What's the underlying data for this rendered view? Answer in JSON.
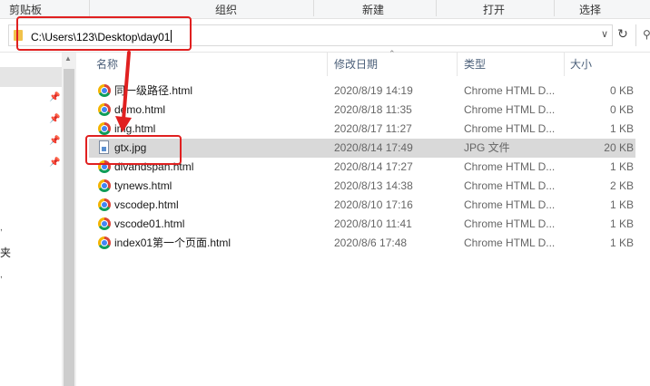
{
  "ribbon": {
    "groups": [
      "剪贴板",
      "组织",
      "新建",
      "打开",
      "选择"
    ]
  },
  "address": {
    "path": "C:\\Users\\123\\Desktop\\day01"
  },
  "nav": {
    "partial_item": "夹"
  },
  "columns": {
    "name": "名称",
    "date": "修改日期",
    "type": "类型",
    "size": "大小"
  },
  "files": [
    {
      "name": "同一级路径.html",
      "date": "2020/8/19 14:19",
      "type": "Chrome HTML D...",
      "size": "0 KB",
      "icon": "chrome-icon"
    },
    {
      "name": "demo.html",
      "date": "2020/8/18 11:35",
      "type": "Chrome HTML D...",
      "size": "0 KB",
      "icon": "chrome-icon"
    },
    {
      "name": "img.html",
      "date": "2020/8/17 11:27",
      "type": "Chrome HTML D...",
      "size": "1 KB",
      "icon": "chrome-icon"
    },
    {
      "name": "gtx.jpg",
      "date": "2020/8/14 17:49",
      "type": "JPG 文件",
      "size": "20 KB",
      "icon": "jpg-file-icon"
    },
    {
      "name": "divandspan.html",
      "date": "2020/8/14 17:27",
      "type": "Chrome HTML D...",
      "size": "1 KB",
      "icon": "chrome-icon"
    },
    {
      "name": "tynews.html",
      "date": "2020/8/13 14:38",
      "type": "Chrome HTML D...",
      "size": "2 KB",
      "icon": "chrome-icon"
    },
    {
      "name": "vscodep.html",
      "date": "2020/8/10 17:16",
      "type": "Chrome HTML D...",
      "size": "1 KB",
      "icon": "chrome-icon"
    },
    {
      "name": "vscode01.html",
      "date": "2020/8/10 11:41",
      "type": "Chrome HTML D...",
      "size": "1 KB",
      "icon": "chrome-icon"
    },
    {
      "name": "index01第一个页面.html",
      "date": "2020/8/6 17:48",
      "type": "Chrome HTML D...",
      "size": "1 KB",
      "icon": "chrome-icon"
    }
  ],
  "selected_index": 3,
  "colors": {
    "annotation": "#e02020",
    "selected_row": "#d9d9d9",
    "header_text": "#4c607a"
  }
}
